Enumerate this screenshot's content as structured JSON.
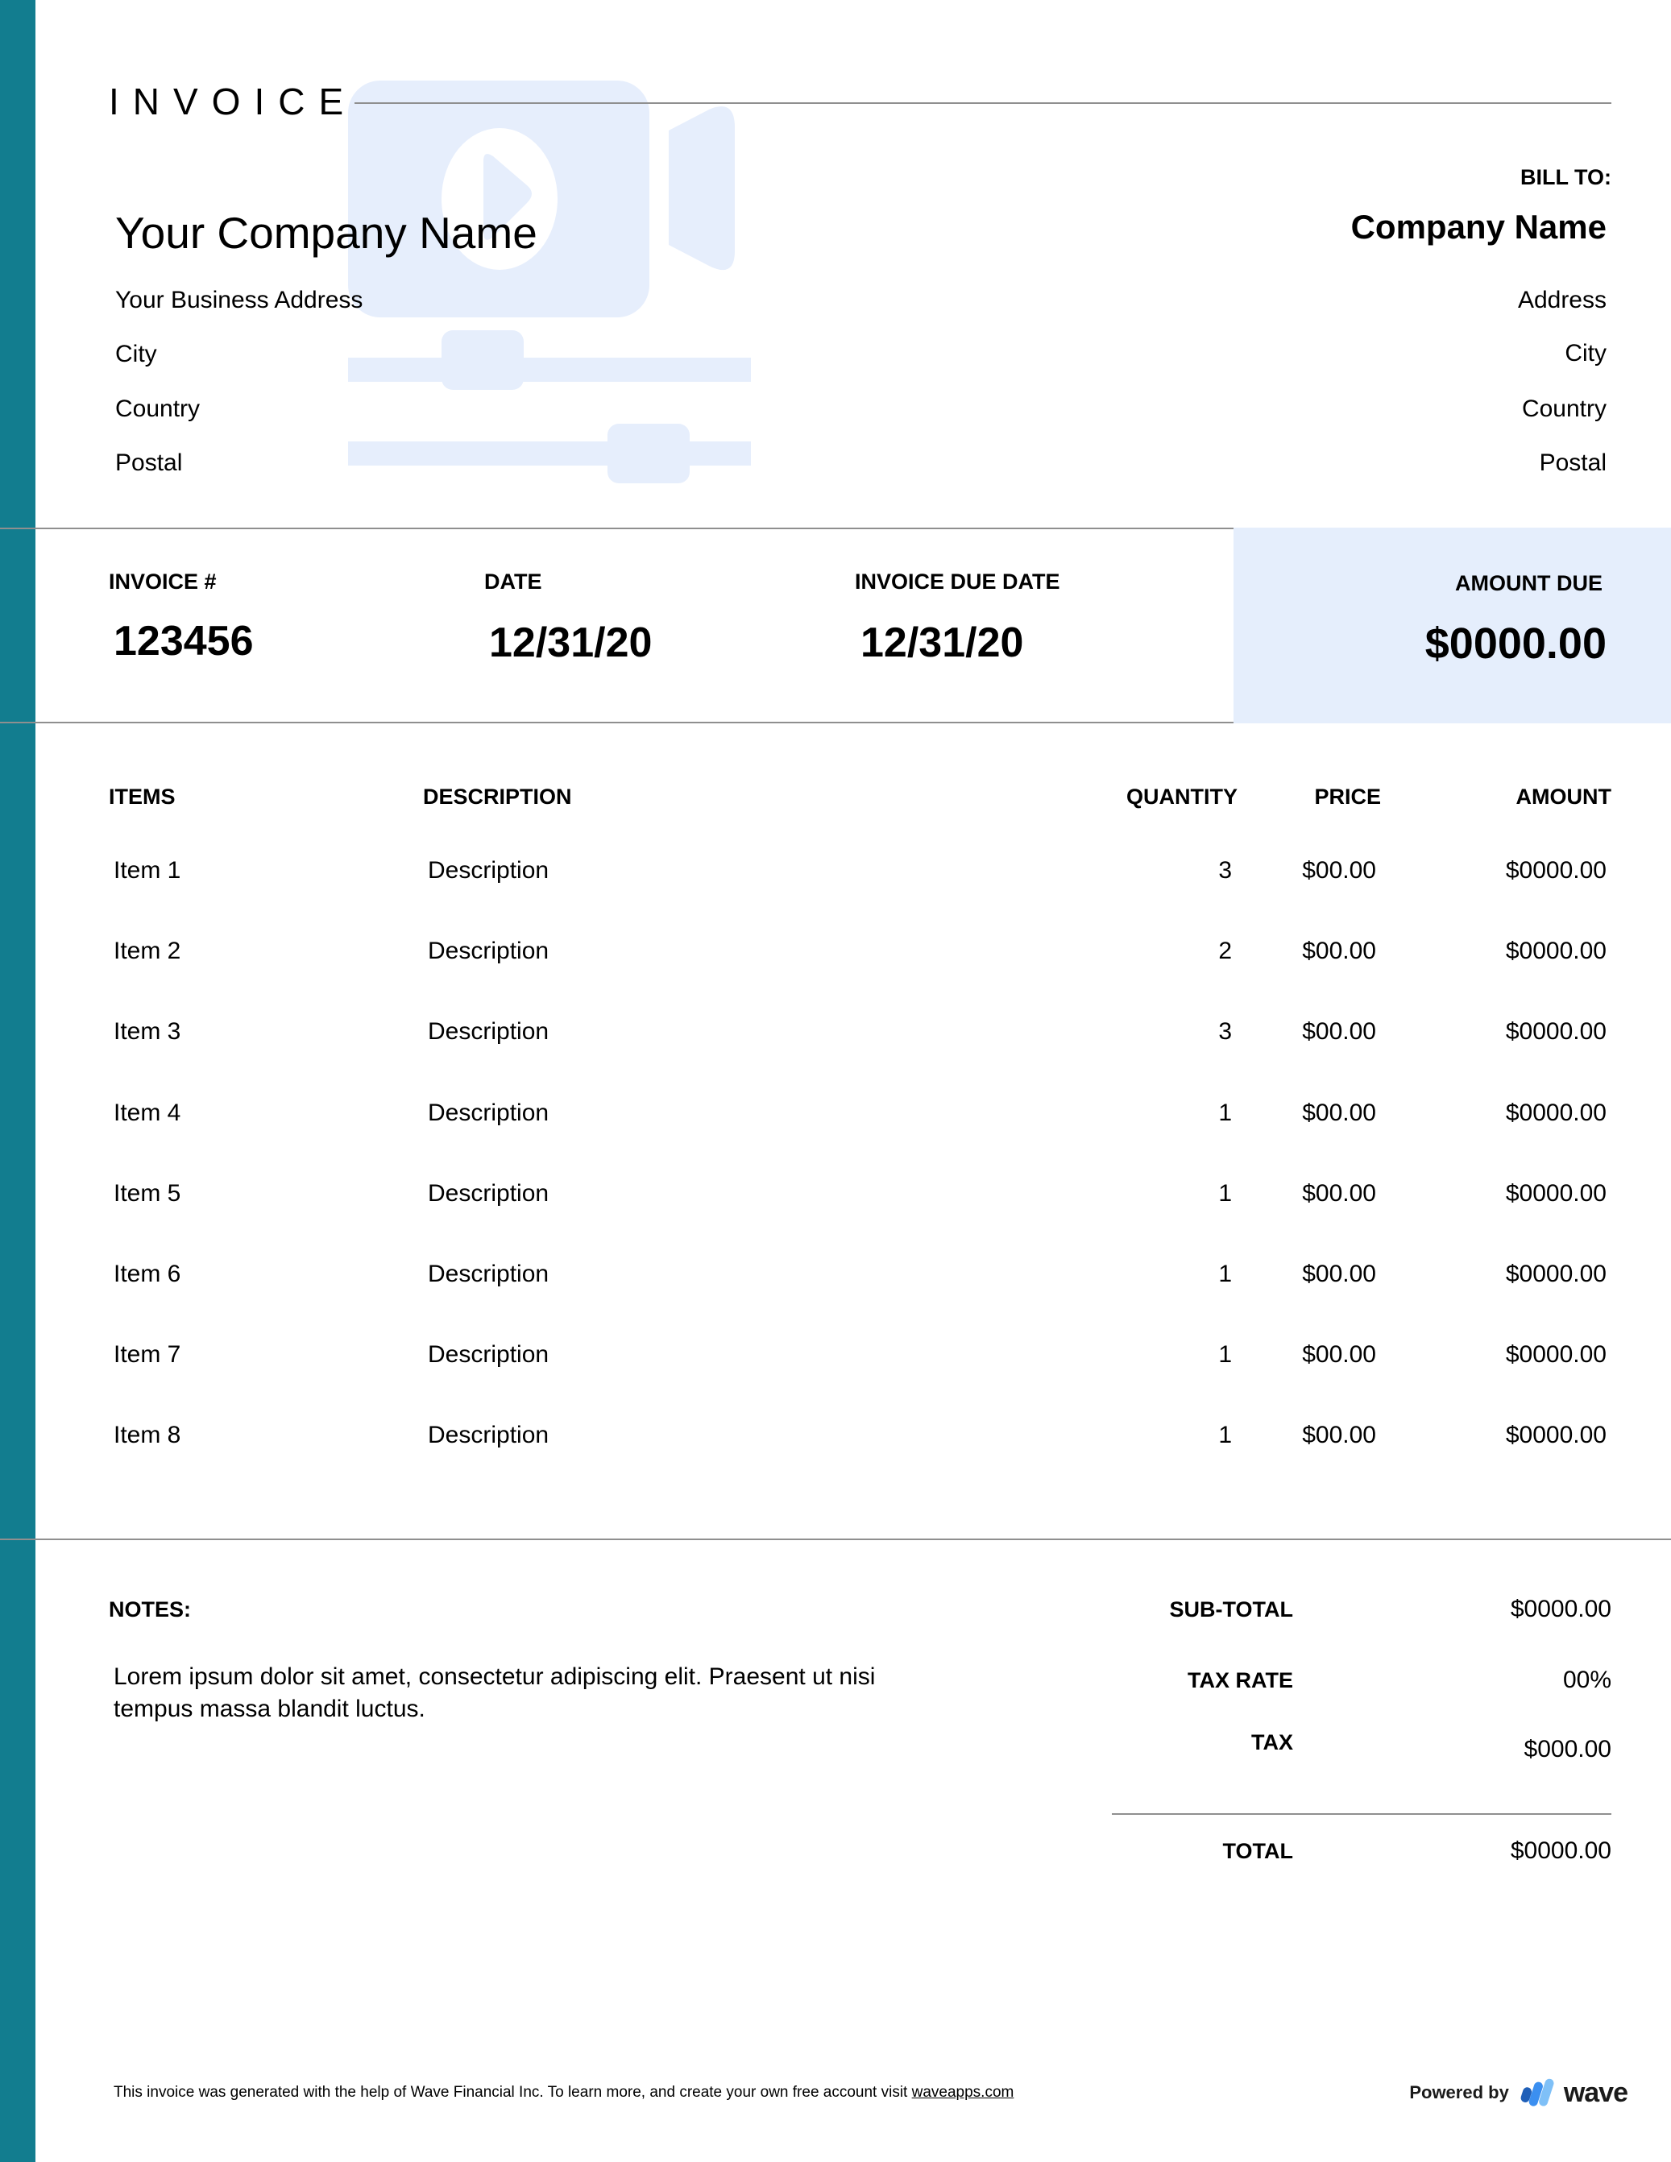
{
  "colors": {
    "sidebar": "#127d8f",
    "amount_box": "#e5eefc",
    "watermark": "#e6eefc",
    "rule": "#8f8f8f",
    "wave_blue_dark": "#1f5fb8",
    "wave_blue": "#3b8ff0",
    "wave_blue_light": "#7fc0f7"
  },
  "header": {
    "title": "INVOICE",
    "watermark_icon": "video-camera-icon"
  },
  "sender": {
    "company_name": "Your Company Name",
    "address": "Your Business Address",
    "city": "City",
    "country": "Country",
    "postal": "Postal"
  },
  "bill_to": {
    "label": "BILL TO:",
    "company_name": "Company Name",
    "address": "Address",
    "city": "City",
    "country": "Country",
    "postal": "Postal"
  },
  "meta": {
    "invoice_number_label": "INVOICE #",
    "invoice_number": "123456",
    "date_label": "DATE",
    "date": "12/31/20",
    "due_date_label": "INVOICE DUE DATE",
    "due_date": "12/31/20",
    "amount_due_label": "AMOUNT DUE",
    "amount_due": "$0000.00"
  },
  "table": {
    "headers": {
      "items": "ITEMS",
      "description": "DESCRIPTION",
      "quantity": "QUANTITY",
      "price": "PRICE",
      "amount": "AMOUNT"
    },
    "rows": [
      {
        "item": "Item 1",
        "description": "Description",
        "quantity": "3",
        "price": "$00.00",
        "amount": "$0000.00"
      },
      {
        "item": "Item 2",
        "description": "Description",
        "quantity": "2",
        "price": "$00.00",
        "amount": "$0000.00"
      },
      {
        "item": "Item 3",
        "description": "Description",
        "quantity": "3",
        "price": "$00.00",
        "amount": "$0000.00"
      },
      {
        "item": "Item 4",
        "description": "Description",
        "quantity": "1",
        "price": "$00.00",
        "amount": "$0000.00"
      },
      {
        "item": "Item 5",
        "description": "Description",
        "quantity": "1",
        "price": "$00.00",
        "amount": "$0000.00"
      },
      {
        "item": "Item 6",
        "description": "Description",
        "quantity": "1",
        "price": "$00.00",
        "amount": "$0000.00"
      },
      {
        "item": "Item 7",
        "description": "Description",
        "quantity": "1",
        "price": "$00.00",
        "amount": "$0000.00"
      },
      {
        "item": "Item 8",
        "description": "Description",
        "quantity": "1",
        "price": "$00.00",
        "amount": "$0000.00"
      }
    ]
  },
  "notes": {
    "label": "NOTES:",
    "text": "Lorem ipsum dolor sit amet, consectetur adipiscing elit. Praesent ut nisi tempus massa blandit luctus."
  },
  "totals": {
    "subtotal_label": "SUB-TOTAL",
    "subtotal": "$0000.00",
    "tax_rate_label": "TAX RATE",
    "tax_rate": "00%",
    "tax_label": "TAX",
    "tax": "$000.00",
    "total_label": "TOTAL",
    "total": "$0000.00"
  },
  "footer": {
    "text": "This invoice was generated with the help of Wave Financial Inc. To learn more, and create your own free account visit ",
    "link_text": "waveapps.com",
    "powered_by": "Powered by",
    "brand": "wave"
  }
}
